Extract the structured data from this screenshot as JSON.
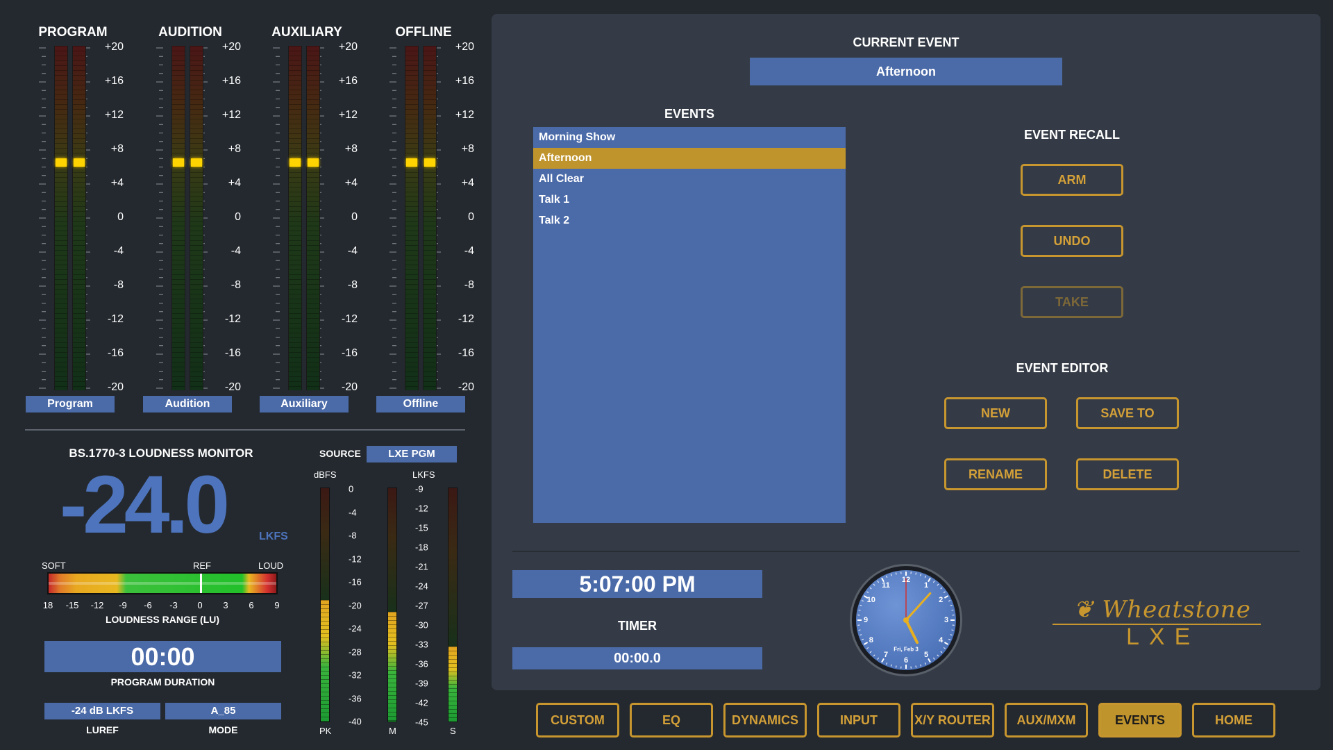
{
  "meters": [
    {
      "title": "PROGRAM",
      "label": "Program"
    },
    {
      "title": "AUDITION",
      "label": "Audition"
    },
    {
      "title": "AUXILIARY",
      "label": "Auxiliary"
    },
    {
      "title": "OFFLINE",
      "label": "Offline"
    }
  ],
  "meter_scale": [
    "+20",
    "+16",
    "+12",
    "+8",
    "+4",
    "0",
    "-4",
    "-8",
    "-12",
    "-16",
    "-20"
  ],
  "loudness": {
    "title": "BS.1770-3 LOUDNESS MONITOR",
    "value": "-24.0",
    "unit": "LKFS",
    "soft": "SOFT",
    "ref": "REF",
    "loud": "LOUD",
    "range_scale": [
      "18",
      "-15",
      "-12",
      "-9",
      "-6",
      "-3",
      "0",
      "3",
      "6",
      "9"
    ],
    "range_label": "LOUDNESS RANGE (LU)",
    "duration": "00:00",
    "duration_label": "PROGRAM DURATION",
    "luref": "-24 dB LKFS",
    "luref_label": "LUREF",
    "mode": "A_85",
    "mode_label": "MODE"
  },
  "source": {
    "label": "SOURCE",
    "value": "LXE PGM",
    "dbfs_label": "dBFS",
    "lkfs_label": "LKFS",
    "dbfs_scale": [
      "0",
      "-4",
      "-8",
      "-12",
      "-16",
      "-20",
      "-24",
      "-28",
      "-32",
      "-36",
      "-40"
    ],
    "lkfs_scale": [
      "-9",
      "-12",
      "-15",
      "-18",
      "-21",
      "-24",
      "-27",
      "-30",
      "-33",
      "-36",
      "-39",
      "-42",
      "-45"
    ],
    "pk_label": "PK",
    "m_label": "M",
    "s_label": "S",
    "pk_level": 0.52,
    "m_level": 0.47,
    "s_level": 0.32
  },
  "current_event": {
    "title": "CURRENT EVENT",
    "value": "Afternoon"
  },
  "events": {
    "title": "EVENTS",
    "items": [
      "Morning Show",
      "Afternoon",
      "All Clear",
      "Talk 1",
      "Talk 2"
    ],
    "selected": 1
  },
  "recall": {
    "title": "EVENT RECALL",
    "arm": "ARM",
    "undo": "UNDO",
    "take": "TAKE"
  },
  "editor": {
    "title": "EVENT EDITOR",
    "new": "NEW",
    "save_to": "SAVE TO",
    "rename": "RENAME",
    "delete": "DELETE"
  },
  "time": {
    "clock": "5:07:00 PM",
    "timer_label": "TIMER",
    "timer": "00:00.0"
  },
  "analog_clock": {
    "numbers": [
      "12",
      "1",
      "2",
      "3",
      "4",
      "5",
      "6",
      "7",
      "8",
      "9",
      "10",
      "11"
    ],
    "date": "Fri, Feb 3",
    "hour": 5,
    "minute": 7,
    "second": 0
  },
  "logo": {
    "brand": "Wheatstone",
    "model": "LXE"
  },
  "nav": [
    "CUSTOM",
    "EQ",
    "DYNAMICS",
    "INPUT",
    "X/Y ROUTER",
    "AUX/MXM",
    "EVENTS",
    "HOME"
  ],
  "nav_active": 6,
  "colors": {
    "accent": "#c8962e",
    "blue": "#4a6aa8",
    "panel": "#343b46",
    "background": "#24292f"
  }
}
